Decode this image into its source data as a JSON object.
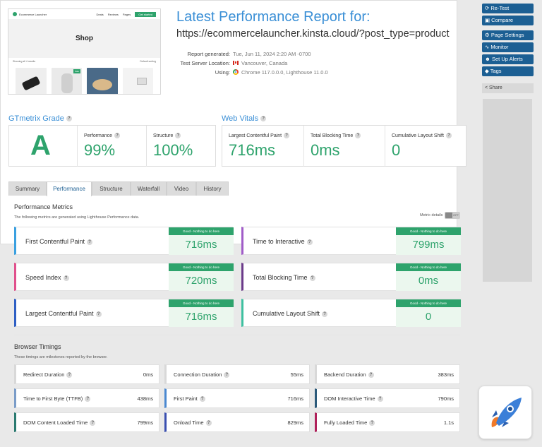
{
  "thumbnail": {
    "site_name": "Ecommerce Launcher",
    "nav": [
      "Deals",
      "Reviews",
      "Pages"
    ],
    "cta": "Get started",
    "hero_title": "Shop",
    "row_left": "Showing all 4 results",
    "row_right": "Default sorting",
    "sale_badge": "Sale"
  },
  "report": {
    "title": "Latest Performance Report for:",
    "url": "https://ecommercelauncher.kinsta.cloud/?post_type=product",
    "meta": [
      {
        "label": "Report generated:",
        "value": "Tue, Jun 11, 2024 2:20 AM -0700"
      },
      {
        "label": "Test Server Location:",
        "value": "Vancouver, Canada"
      },
      {
        "label": "Using:",
        "value": "Chrome 117.0.0.0, Lighthouse 11.0.0"
      }
    ]
  },
  "sidebar": {
    "buttons": [
      {
        "label": "Re-Test",
        "icon": "refresh-icon"
      },
      {
        "label": "Compare",
        "icon": "compare-icon"
      },
      {
        "label": "Page Settings",
        "icon": "gear-icon"
      },
      {
        "label": "Monitor",
        "icon": "pulse-icon"
      },
      {
        "label": "Set Up Alerts",
        "icon": "users-icon"
      },
      {
        "label": "Tags",
        "icon": "tag-icon"
      }
    ],
    "share_label": "Share"
  },
  "grade": {
    "title": "GTmetrix Grade",
    "letter": "A",
    "performance_label": "Performance",
    "performance_value": "99%",
    "structure_label": "Structure",
    "structure_value": "100%"
  },
  "vitals": {
    "title": "Web Vitals",
    "items": [
      {
        "label": "Largest Contentful Paint",
        "value": "716ms"
      },
      {
        "label": "Total Blocking Time",
        "value": "0ms"
      },
      {
        "label": "Cumulative Layout Shift",
        "value": "0"
      }
    ]
  },
  "tabs": [
    "Summary",
    "Performance",
    "Structure",
    "Waterfall",
    "Video",
    "History"
  ],
  "active_tab": "Performance",
  "performance": {
    "title": "Performance Metrics",
    "subtitle": "The following metrics are generated using Lighthouse Performance data.",
    "metric_details_label": "Metric details",
    "toggle_label": "OFF",
    "badge_text": "Good - Nothing to do here",
    "metrics": [
      {
        "name": "First Contentful Paint",
        "value": "716ms",
        "color": "#3aa0e0"
      },
      {
        "name": "Time to Interactive",
        "value": "799ms",
        "color": "#a05cc8"
      },
      {
        "name": "Speed Index",
        "value": "720ms",
        "color": "#e0508c"
      },
      {
        "name": "Total Blocking Time",
        "value": "0ms",
        "color": "#6b3a8a"
      },
      {
        "name": "Largest Contentful Paint",
        "value": "716ms",
        "color": "#2e5fc4"
      },
      {
        "name": "Cumulative Layout Shift",
        "value": "0",
        "color": "#3ec0a0"
      }
    ]
  },
  "timings": {
    "title": "Browser Timings",
    "subtitle": "These timings are milestones reported by the browser.",
    "items": [
      {
        "name": "Redirect Duration",
        "value": "0ms",
        "color": "#d8d8d8"
      },
      {
        "name": "Connection Duration",
        "value": "55ms",
        "color": "#d8d8d8"
      },
      {
        "name": "Backend Duration",
        "value": "383ms",
        "color": "#d8d8d8"
      },
      {
        "name": "Time to First Byte (TTFB)",
        "value": "438ms",
        "color": "#7a9cc8"
      },
      {
        "name": "First Paint",
        "value": "716ms",
        "color": "#4a88d0"
      },
      {
        "name": "DOM Interactive Time",
        "value": "790ms",
        "color": "#2c5a7a"
      },
      {
        "name": "DOM Content Loaded Time",
        "value": "799ms",
        "color": "#2a7a70"
      },
      {
        "name": "Onload Time",
        "value": "829ms",
        "color": "#3a4fb0"
      },
      {
        "name": "Fully Loaded Time",
        "value": "1.1s",
        "color": "#b0205a"
      }
    ]
  }
}
